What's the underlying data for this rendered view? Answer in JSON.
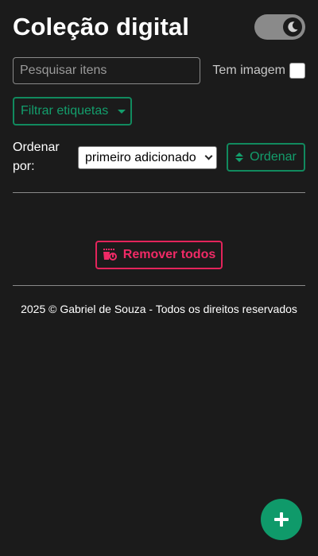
{
  "header": {
    "title": "Coleção digital",
    "theme_toggle_icon": "moon-icon"
  },
  "search": {
    "placeholder": "Pesquisar itens",
    "value": "",
    "has_image_label": "Tem imagem",
    "has_image_checked": false
  },
  "filter": {
    "label": "Filtrar etiquetas",
    "icon": "caret-down-icon"
  },
  "sort": {
    "label": "Ordenar por:",
    "selected": "primeiro adicionado",
    "button_label": "Ordenar",
    "button_icon": "sort-icon"
  },
  "actions": {
    "remove_all_label": "Remover todos",
    "remove_all_icon": "trash-icon"
  },
  "footer": {
    "text": "2025 © Gabriel de Souza - Todos os direitos reservados"
  },
  "fab": {
    "icon": "plus-icon"
  },
  "colors": {
    "background": "#1b1b1b",
    "accent_green": "#139e6c",
    "danger_pink": "#f02a66",
    "toggle_bg": "#8a8a8a"
  }
}
